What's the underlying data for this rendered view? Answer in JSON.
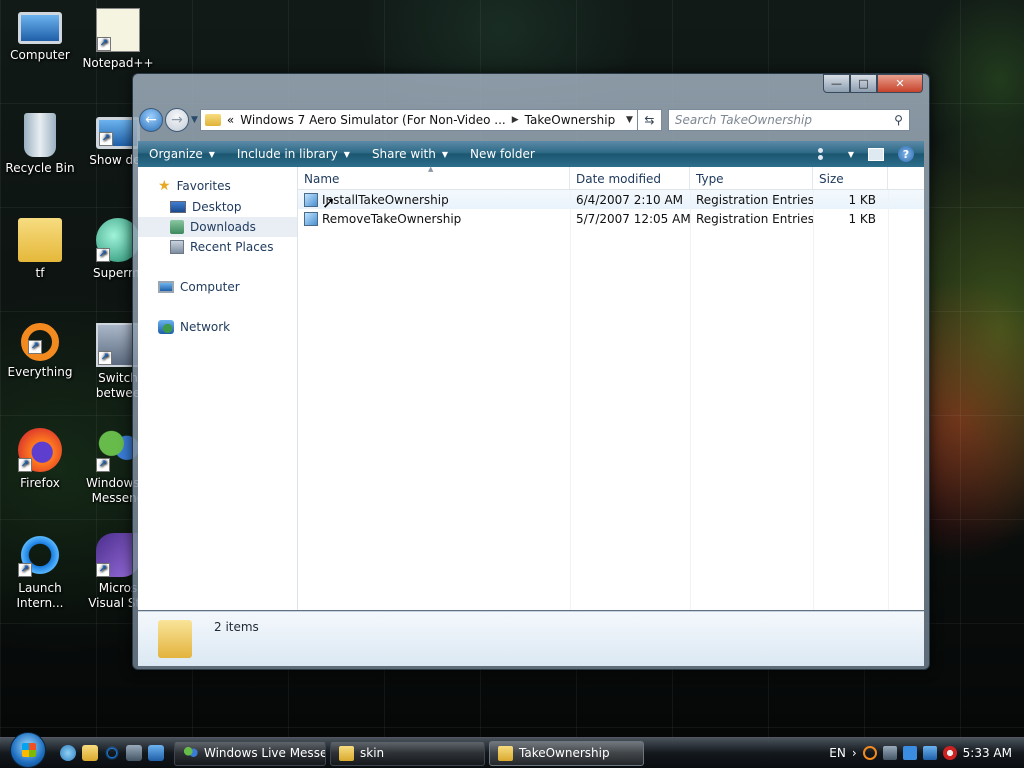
{
  "desktop": {
    "icons": [
      {
        "label": "Computer",
        "icon": "computer-icon"
      },
      {
        "label": "Notepad++",
        "icon": "notepad-icon"
      },
      {
        "label": "Recycle Bin",
        "icon": "recycle-bin-icon"
      },
      {
        "label": "Show des",
        "icon": "show-desktop-icon"
      },
      {
        "label": "tf",
        "icon": "folder-icon"
      },
      {
        "label": "Supermi",
        "icon": "app-orb-icon"
      },
      {
        "label": "Everything",
        "icon": "everything-icon"
      },
      {
        "label": "Switch\nbetwee",
        "icon": "switch-windows-icon"
      },
      {
        "label": "Firefox",
        "icon": "firefox-icon"
      },
      {
        "label": "Windows L\nMesseng",
        "icon": "messenger-icon"
      },
      {
        "label": "Launch\nIntern...",
        "icon": "internet-explorer-icon"
      },
      {
        "label": "Micros\nVisual Stu",
        "icon": "visual-studio-icon"
      }
    ]
  },
  "window": {
    "caption_buttons": {
      "minimize": "—",
      "maximize": "□",
      "close": "✕"
    },
    "address": {
      "chevron": "«",
      "crumbs": [
        "Windows 7 Aero Simulator (For Non-Video ...",
        "TakeOwnership"
      ]
    },
    "search_placeholder": "Search TakeOwnership",
    "toolbar": {
      "organize": "Organize",
      "include_in_library": "Include in library",
      "share_with": "Share with",
      "new_folder": "New folder"
    },
    "nav": {
      "favorites": "Favorites",
      "desktop": "Desktop",
      "downloads": "Downloads",
      "recent_places": "Recent Places",
      "computer": "Computer",
      "network": "Network"
    },
    "columns": {
      "name": "Name",
      "date": "Date modified",
      "type": "Type",
      "size": "Size"
    },
    "files": [
      {
        "name": "InstallTakeOwnership",
        "date": "6/4/2007 2:10 AM",
        "type": "Registration Entries",
        "size": "1 KB"
      },
      {
        "name": "RemoveTakeOwnership",
        "date": "5/7/2007 12:05 AM",
        "type": "Registration Entries",
        "size": "1 KB"
      }
    ],
    "status": "2 items"
  },
  "taskbar": {
    "tasks": [
      {
        "label": "Windows Live Messe...",
        "icon": "messenger-icon",
        "active": false
      },
      {
        "label": "skin",
        "icon": "folder-icon",
        "active": false
      },
      {
        "label": "TakeOwnership",
        "icon": "folder-icon",
        "active": true
      }
    ],
    "language": "EN",
    "clock": "5:33 AM"
  }
}
